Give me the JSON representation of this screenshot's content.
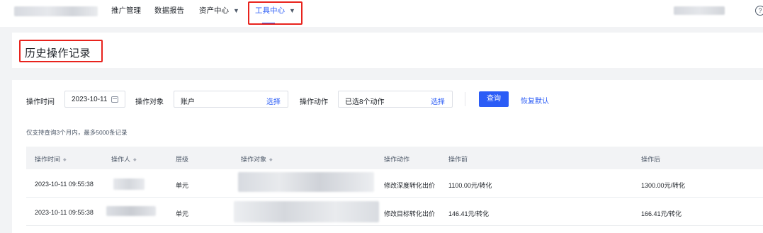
{
  "nav": {
    "items": [
      {
        "label": "推广管理"
      },
      {
        "label": "数据报告"
      },
      {
        "label": "资产中心"
      },
      {
        "label": "工具中心"
      }
    ],
    "help_icon": "?"
  },
  "page": {
    "title": "历史操作记录"
  },
  "filters": {
    "time_label": "操作时间",
    "time_value": "2023-10-11",
    "object_label": "操作对象",
    "object_value": "账户",
    "object_select": "选择",
    "action_label": "操作动作",
    "action_value": "已选8个动作",
    "action_select": "选择",
    "query_button": "查询",
    "reset_button": "恢复默认"
  },
  "hint": "仅支持查询3个月内，最多5000条记录",
  "table": {
    "columns": [
      "操作时间",
      "操作人",
      "层级",
      "操作对象",
      "操作动作",
      "操作前",
      "操作后"
    ],
    "rows": [
      {
        "time": "2023-10-11 09:55:38",
        "level": "单元",
        "action": "修改深度转化出价",
        "before": "1100.00元/转化",
        "after": "1300.00元/转化"
      },
      {
        "time": "2023-10-11 09:55:38",
        "level": "单元",
        "action": "修改目标转化出价",
        "before": "146.41元/转化",
        "after": "166.41元/转化"
      }
    ]
  },
  "colors": {
    "accent": "#2b5cf6",
    "highlight": "#e8231d"
  }
}
